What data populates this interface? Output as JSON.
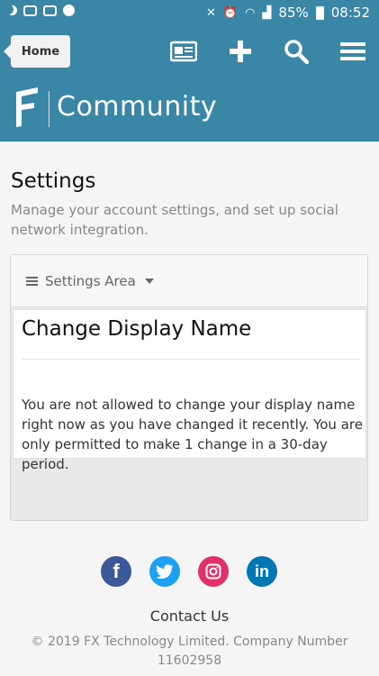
{
  "status_bar": {
    "battery": "85%",
    "time": "08:52",
    "icons": [
      "moon-icon",
      "voicemail-icon",
      "youtube-icon",
      "app-icon",
      "mute-icon",
      "alarm-icon",
      "wifi-icon",
      "signal-icon",
      "battery-icon"
    ]
  },
  "nav": {
    "home_label": "Home",
    "icons": [
      "newspaper-icon",
      "plus-icon",
      "search-icon",
      "menu-icon"
    ]
  },
  "brand": {
    "title": "Community",
    "logo_icon": "fx-logo-icon"
  },
  "page": {
    "title": "Settings",
    "description": "Manage your account settings, and set up social network integration."
  },
  "settings_area": {
    "label": "Settings Area"
  },
  "card": {
    "title": "Change Display Name",
    "message": "You are not allowed to change your display name right now as you have changed it recently. You are only permitted to make 1 change in a 30-day period."
  },
  "footer": {
    "social": [
      {
        "name": "facebook",
        "glyph": "f",
        "color": "#3b5998"
      },
      {
        "name": "twitter",
        "glyph": "t",
        "color": "#1da1f2"
      },
      {
        "name": "instagram",
        "glyph": "",
        "color": "#e1306c"
      },
      {
        "name": "linkedin",
        "glyph": "in",
        "color": "#0077b5"
      }
    ],
    "contact_label": "Contact Us",
    "copyright": "© 2019 FX Technology Limited. Company Number 11602958"
  },
  "colors": {
    "brand": "#3a86a6",
    "background": "#f5f5f5"
  }
}
